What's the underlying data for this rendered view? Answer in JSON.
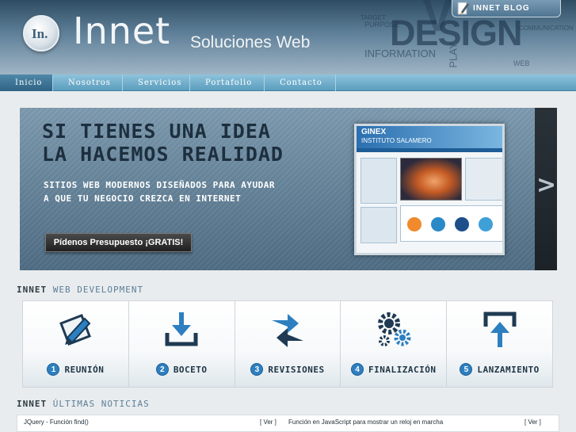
{
  "header": {
    "logo_mark": "In.",
    "brand": "Innet",
    "tagline": "Soluciones Web",
    "blog_button": "INNET  BLOG",
    "bg_words": {
      "design": "DESIGN",
      "information": "INFORMATION",
      "purpose": "PURPOSE",
      "target": "TARGET",
      "communication": "COMMUNICATION",
      "play": "PLAY",
      "web": "WEB",
      "v": "V"
    }
  },
  "nav": {
    "items": [
      {
        "label": "Inicio",
        "active": true
      },
      {
        "label": "Nosotros",
        "active": false
      },
      {
        "label": "Servicios",
        "active": false
      },
      {
        "label": "Portafolio",
        "active": false
      },
      {
        "label": "Contacto",
        "active": false
      }
    ]
  },
  "banner": {
    "headline_1": "SI TIENES UNA IDEA",
    "headline_2": "LA HACEMOS REALIDAD",
    "sub_1": "SITIOS WEB MODERNOS DISEÑADOS PARA AYUDAR",
    "sub_2": "A QUE TU NEGOCIO CREZCA EN INTERNET",
    "cta": "Pídenos Presupuesto ¡GRATIS!",
    "next_arrow": ">",
    "preview": {
      "title": "GINEX",
      "subtitle": "INSTITUTO SALAMERO"
    }
  },
  "dev_section": {
    "title_strong": "INNET",
    "title_light": "WEB DEVELOPMENT",
    "steps": [
      {
        "num": "1",
        "label": "REUNIÓN",
        "icon": "pencil-paper-icon"
      },
      {
        "num": "2",
        "label": "BOCETO",
        "icon": "download-tray-icon"
      },
      {
        "num": "3",
        "label": "REVISIONES",
        "icon": "refresh-arrows-icon"
      },
      {
        "num": "4",
        "label": "FINALIZACIÓN",
        "icon": "gears-icon"
      },
      {
        "num": "5",
        "label": "LANZAMIENTO",
        "icon": "upload-tray-icon"
      }
    ]
  },
  "news_section": {
    "title_strong": "INNET",
    "title_light": "ÚLTIMAS NOTICIAS",
    "items": [
      {
        "title": "JQuery - Función find()",
        "link": "[ Ver ]"
      },
      {
        "title": "Función en JavaScript para mostrar un reloj en marcha",
        "link": "[ Ver ]"
      }
    ]
  },
  "colors": {
    "nav_blue": "#5a9dbd",
    "accent_blue": "#2d7fc0",
    "banner_slate": "#6a889e",
    "dark_text": "#1d2f3e"
  }
}
